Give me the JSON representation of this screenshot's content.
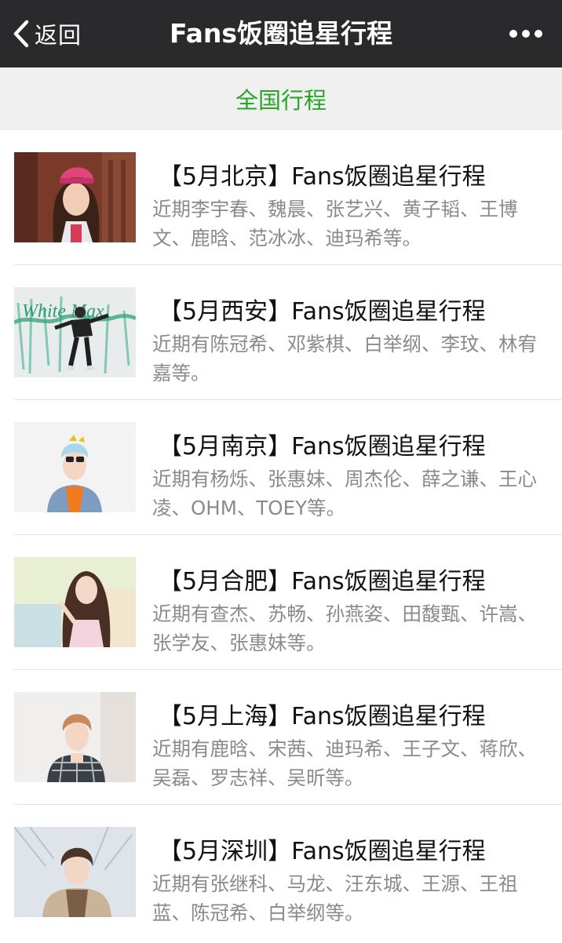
{
  "nav": {
    "back_label": "返回",
    "title": "Fans饭圈追星行程",
    "more_icon": "more-dots-icon"
  },
  "tab": {
    "active_label": "全国行程",
    "active_color": "#2aa52a"
  },
  "items": [
    {
      "title": "【5月北京】Fans饭圈追星行程",
      "desc": "近期李宇春、魏晨、张艺兴、黄子韬、王博文、鹿晗、范冰冰、迪玛希等。"
    },
    {
      "title": "【5月西安】Fans饭圈追星行程",
      "desc": "近期有陈冠希、邓紫棋、白举纲、李玟、林宥嘉等。"
    },
    {
      "title": "【5月南京】Fans饭圈追星行程",
      "desc": "近期有杨烁、张惠妹、周杰伦、薛之谦、王心凌、OHM、TOEY等。"
    },
    {
      "title": "【5月合肥】Fans饭圈追星行程",
      "desc": "近期有查杰、苏畅、孙燕姿、田馥甄、许嵩、张学友、张惠妹等。"
    },
    {
      "title": "【5月上海】Fans饭圈追星行程",
      "desc": "近期有鹿晗、宋茜、迪玛希、王子文、蒋欣、吴磊、罗志祥、吴昕等。"
    },
    {
      "title": "【5月深圳】Fans饭圈追星行程",
      "desc": "近期有张继科、马龙、汪东城、王源、王祖蓝、陈冠希、白举纲等。"
    }
  ],
  "thumb_text": {
    "graffiti": "White Max"
  }
}
